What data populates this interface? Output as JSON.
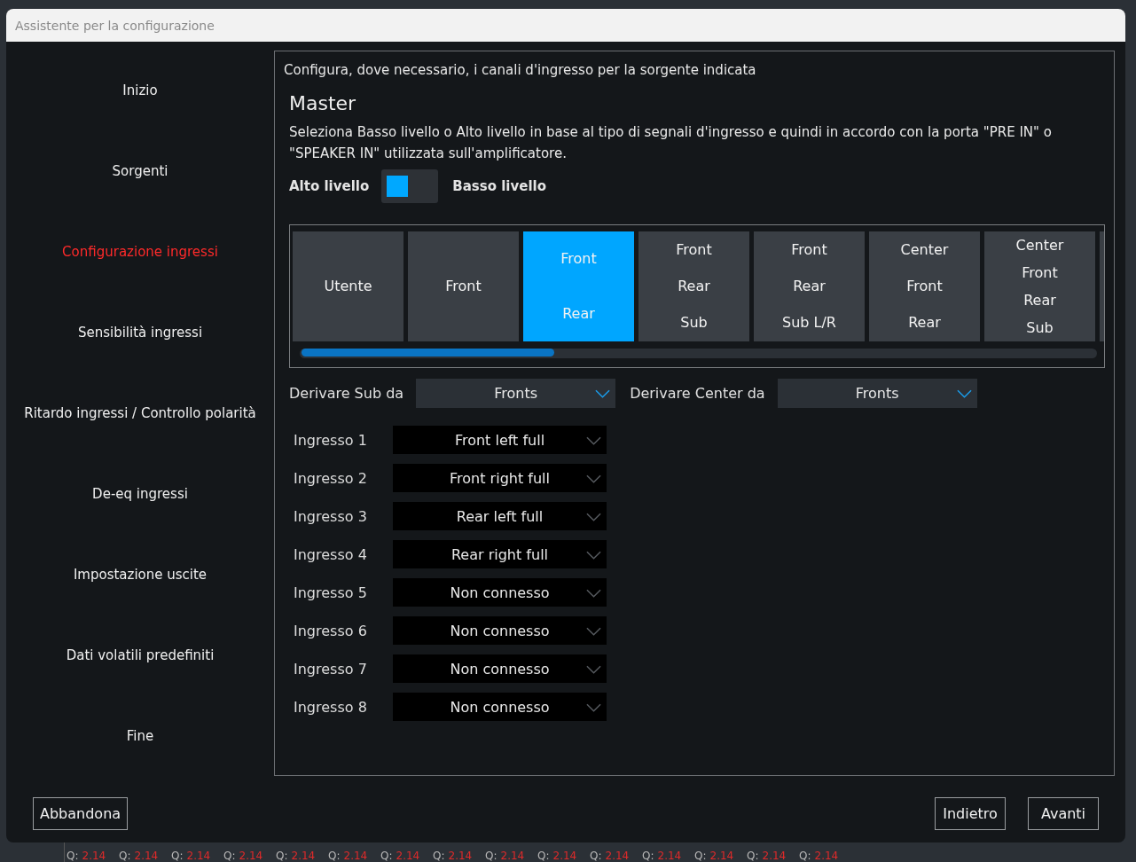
{
  "window": {
    "title": "Assistente per la configurazione"
  },
  "sidebar": {
    "items": [
      {
        "label": "Inizio",
        "selected": false
      },
      {
        "label": "Sorgenti",
        "selected": false
      },
      {
        "label": "Configurazione ingressi",
        "selected": true
      },
      {
        "label": "Sensibilità ingressi",
        "selected": false
      },
      {
        "label": "Ritardo ingressi / Controllo polarità",
        "selected": false
      },
      {
        "label": "De-eq ingressi",
        "selected": false
      },
      {
        "label": "Impostazione uscite",
        "selected": false
      },
      {
        "label": "Dati volatili predefiniti",
        "selected": false
      },
      {
        "label": "Fine",
        "selected": false
      }
    ]
  },
  "panel": {
    "intro": "Configura, dove necessario, i canali d'ingresso per la sorgente indicata",
    "heading": "Master",
    "description": "Seleziona Basso livello o Alto livello in base al tipo di segnali d'ingresso e quindi in accordo con la porta \"PRE IN\" o \"SPEAKER IN\" utilizzata sull'amplificatore.",
    "level_switch": {
      "left_label": "Alto livello",
      "right_label": "Basso livello",
      "on": false
    },
    "presets": [
      {
        "lines": [
          "Utente"
        ],
        "selected": false
      },
      {
        "lines": [
          "Front"
        ],
        "selected": false
      },
      {
        "lines": [
          "Front",
          "Rear"
        ],
        "selected": true
      },
      {
        "lines": [
          "Front",
          "Rear",
          "Sub"
        ],
        "selected": false
      },
      {
        "lines": [
          "Front",
          "Rear",
          "Sub L/R"
        ],
        "selected": false
      },
      {
        "lines": [
          "Center",
          "Front",
          "Rear"
        ],
        "selected": false
      },
      {
        "lines": [
          "Center",
          "Front",
          "Rear",
          "Sub"
        ],
        "selected": false
      }
    ],
    "derive": [
      {
        "label": "Derivare Sub da",
        "value": "Fronts"
      },
      {
        "label": "Derivare Center da",
        "value": "Fronts"
      }
    ],
    "inputs": [
      {
        "label": "Ingresso 1",
        "value": "Front left full"
      },
      {
        "label": "Ingresso 2",
        "value": "Front right full"
      },
      {
        "label": "Ingresso 3",
        "value": "Rear left full"
      },
      {
        "label": "Ingresso 4",
        "value": "Rear right full"
      },
      {
        "label": "Ingresso 5",
        "value": "Non connesso"
      },
      {
        "label": "Ingresso 6",
        "value": "Non connesso"
      },
      {
        "label": "Ingresso 7",
        "value": "Non connesso"
      },
      {
        "label": "Ingresso 8",
        "value": "Non connesso"
      }
    ]
  },
  "footer": {
    "left_buttons": [
      "Abbandona"
    ],
    "right_buttons": [
      "Indietro",
      "Avanti"
    ]
  },
  "background_strip": [
    {
      "label": "Q:",
      "value": "2.14"
    },
    {
      "label": "Q:",
      "value": "2.14"
    },
    {
      "label": "Q:",
      "value": "2.14"
    },
    {
      "label": "Q:",
      "value": "2.14"
    },
    {
      "label": "Q:",
      "value": "2.14"
    },
    {
      "label": "Q:",
      "value": "2.14"
    },
    {
      "label": "Q:",
      "value": "2.14"
    },
    {
      "label": "Q:",
      "value": "2.14"
    },
    {
      "label": "Q:",
      "value": "2.14"
    },
    {
      "label": "Q:",
      "value": "2.14"
    },
    {
      "label": "Q:",
      "value": "2.14"
    },
    {
      "label": "Q:",
      "value": "2.14"
    },
    {
      "label": "Q:",
      "value": "2.14"
    },
    {
      "label": "Q:",
      "value": "2.14"
    },
    {
      "label": "Q:",
      "value": "2.14"
    }
  ]
}
